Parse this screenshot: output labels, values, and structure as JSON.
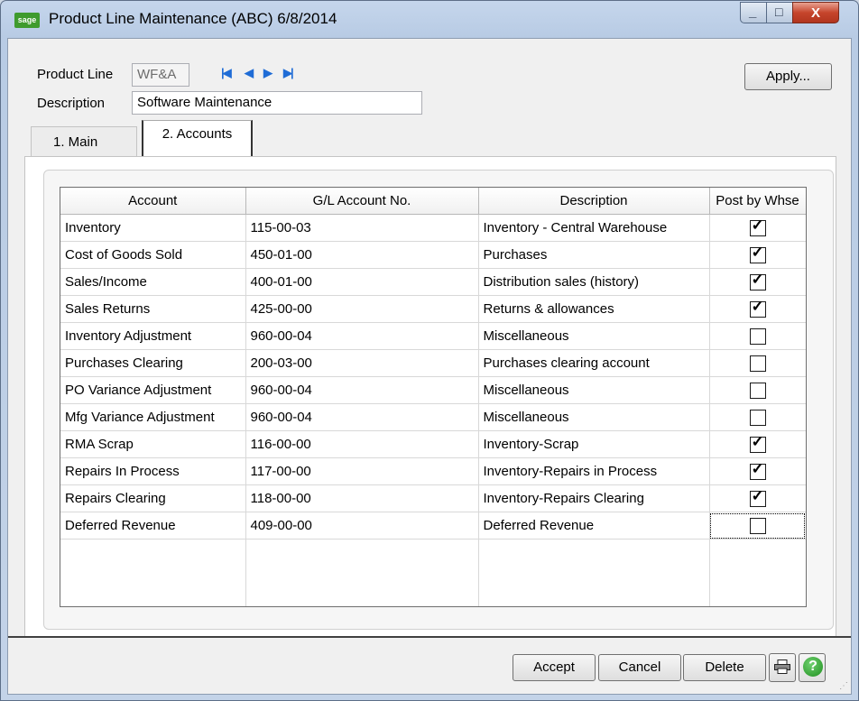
{
  "window": {
    "icon_text": "sage",
    "title": "Product Line Maintenance (ABC) 6/8/2014",
    "minimize_glyph": "_",
    "maximize_glyph": "□",
    "close_glyph": "X"
  },
  "header": {
    "product_line_label": "Product Line",
    "product_line_value": "WF&A",
    "description_label": "Description",
    "description_value": "Software Maintenance",
    "apply_label": "Apply..."
  },
  "nav": {
    "first": "|◀",
    "prev": "◀",
    "next": "▶",
    "last": "▶|"
  },
  "tabs": [
    {
      "label": "1. Main",
      "active": false
    },
    {
      "label": "2. Accounts",
      "active": true
    }
  ],
  "grid": {
    "columns": [
      "Account",
      "G/L Account No.",
      "Description",
      "Post by Whse"
    ],
    "rows": [
      {
        "account": "Inventory",
        "gl": "115-00-03",
        "desc": "Inventory - Central Warehouse",
        "post": true
      },
      {
        "account": "Cost of Goods Sold",
        "gl": "450-01-00",
        "desc": "Purchases",
        "post": true
      },
      {
        "account": "Sales/Income",
        "gl": "400-01-00",
        "desc": "Distribution sales (history)",
        "post": true
      },
      {
        "account": "Sales Returns",
        "gl": "425-00-00",
        "desc": "Returns & allowances",
        "post": true
      },
      {
        "account": "Inventory Adjustment",
        "gl": "960-00-04",
        "desc": "Miscellaneous",
        "post": false
      },
      {
        "account": "Purchases Clearing",
        "gl": "200-03-00",
        "desc": "Purchases clearing account",
        "post": false
      },
      {
        "account": "PO Variance Adjustment",
        "gl": "960-00-04",
        "desc": "Miscellaneous",
        "post": false
      },
      {
        "account": "Mfg Variance Adjustment",
        "gl": "960-00-04",
        "desc": "Miscellaneous",
        "post": false
      },
      {
        "account": "RMA Scrap",
        "gl": "116-00-00",
        "desc": "Inventory-Scrap",
        "post": true
      },
      {
        "account": "Repairs In Process",
        "gl": "117-00-00",
        "desc": "Inventory-Repairs in Process",
        "post": true
      },
      {
        "account": "Repairs Clearing",
        "gl": "118-00-00",
        "desc": "Inventory-Repairs Clearing",
        "post": true
      },
      {
        "account": "Deferred Revenue",
        "gl": "409-00-00",
        "desc": "Deferred Revenue",
        "post": false
      }
    ]
  },
  "footer": {
    "accept_label": "Accept",
    "cancel_label": "Cancel",
    "delete_label": "Delete",
    "help_glyph": "?"
  },
  "colors": {
    "title_bar": "#b8cbe4",
    "nav_arrows": "#1f6cd6",
    "close_button": "#c6452c",
    "help_icon": "#1e8f1e"
  },
  "icons": [
    "sage-logo-icon",
    "first-record-icon",
    "previous-record-icon",
    "next-record-icon",
    "last-record-icon",
    "printer-icon",
    "help-icon"
  ]
}
